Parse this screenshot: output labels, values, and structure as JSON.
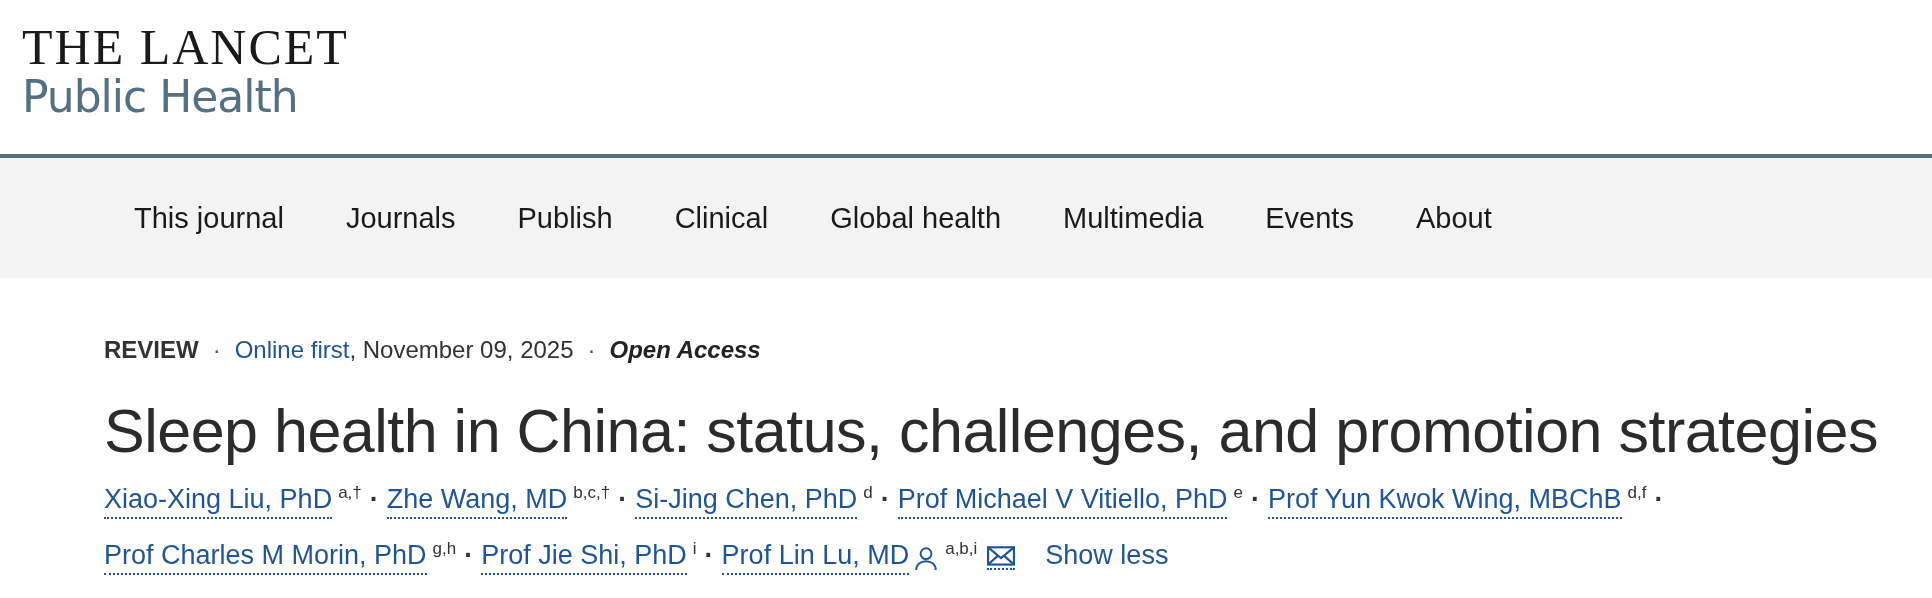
{
  "logo": {
    "title": "THE LANCET",
    "subtitle": "Public Health"
  },
  "nav": [
    {
      "label": "This journal"
    },
    {
      "label": "Journals"
    },
    {
      "label": "Publish"
    },
    {
      "label": "Clinical"
    },
    {
      "label": "Global health"
    },
    {
      "label": "Multimedia"
    },
    {
      "label": "Events"
    },
    {
      "label": "About"
    }
  ],
  "meta": {
    "type": "REVIEW",
    "status": "Online first",
    "date": ", November 09, 2025",
    "access": "Open Access"
  },
  "title": "Sleep health in China: status, challenges, and promotion strategies",
  "author_lines": [
    [
      {
        "name": "Xiao-Xing Liu, PhD",
        "affiliations": "a,†"
      },
      {
        "name": "Zhe Wang, MD",
        "affiliations": "b,c,†"
      },
      {
        "name": "Si-Jing Chen, PhD",
        "affiliations": "d"
      },
      {
        "name": "Prof Michael V Vitiello, PhD",
        "affiliations": "e"
      },
      {
        "name": "Prof Yun Kwok Wing, MBChB",
        "affiliations": "d,f"
      }
    ],
    [
      {
        "name": "Prof Charles M Morin, PhD",
        "affiliations": "g,h"
      },
      {
        "name": "Prof Jie Shi, PhD",
        "affiliations": "i"
      },
      {
        "name": "Prof Lin Lu, MD",
        "affiliations": "a,b,i",
        "corresponding": true
      }
    ]
  ],
  "separator": "·",
  "toggle": "Show less"
}
